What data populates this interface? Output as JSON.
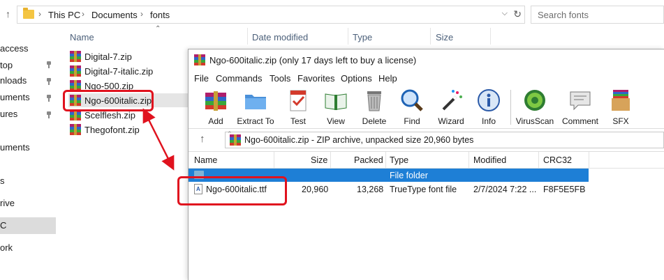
{
  "explorer": {
    "breadcrumb": [
      "This PC",
      "Documents",
      "fonts"
    ],
    "search_placeholder": "Search fonts",
    "nav": [
      " access",
      "top",
      "nloads",
      "uments",
      "ures",
      "uments",
      "s",
      "rive",
      "C",
      "ork"
    ],
    "columns": [
      "Name",
      "Date modified",
      "Type",
      "Size"
    ],
    "files": [
      "Digital-7.zip",
      "Digital-7-italic.zip",
      "Ngo-500.zip",
      "Ngo-600italic.zip",
      "Scelflesh.zip",
      "Thegofont.zip"
    ]
  },
  "winrar": {
    "title": "Ngo-600italic.zip (only 17 days left to buy a license)",
    "menu": [
      "File",
      "Commands",
      "Tools",
      "Favorites",
      "Options",
      "Help"
    ],
    "toolbar": [
      "Add",
      "Extract To",
      "Test",
      "View",
      "Delete",
      "Find",
      "Wizard",
      "Info",
      "VirusScan",
      "Comment",
      "SFX"
    ],
    "path_text": "Ngo-600italic.zip - ZIP archive, unpacked size 20,960 bytes",
    "columns": [
      "Name",
      "Size",
      "Packed",
      "Type",
      "Modified",
      "CRC32"
    ],
    "rows": [
      {
        "name": "..",
        "size": "",
        "packed": "",
        "type": "File folder",
        "modified": "",
        "crc": ""
      },
      {
        "name": "Ngo-600italic.ttf",
        "size": "20,960",
        "packed": "13,268",
        "type": "TrueType font file",
        "modified": "2/7/2024 7:22 ...",
        "crc": "F8F5E5FB"
      }
    ]
  },
  "colors": {
    "annotation": "#e0121e",
    "selection": "#1e7fd6"
  }
}
